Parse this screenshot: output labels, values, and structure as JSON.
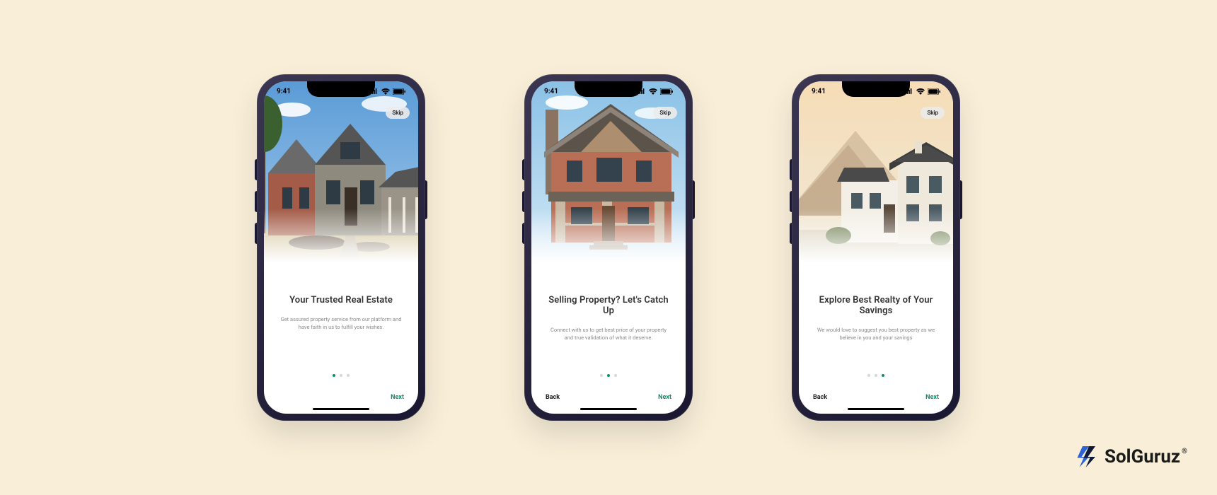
{
  "status": {
    "time": "9:41"
  },
  "skip_label": "Skip",
  "next_label": "Next",
  "back_label": "Back",
  "brand": {
    "name": "SolGuruz",
    "registered": "®"
  },
  "screens": [
    {
      "title": "Your Trusted Real Estate",
      "desc": "Get assured property service from our platform and have faith in us to fulfill your wishes.",
      "active_dot": 0,
      "show_back": false
    },
    {
      "title": "Selling Property? Let's Catch Up",
      "desc": "Connect with us to get best price of your property and true validation of what it deserve.",
      "active_dot": 1,
      "show_back": true
    },
    {
      "title": "Explore Best Realty of Your Savings",
      "desc": "We would love to suggest you best property as we believe in you and your savings",
      "active_dot": 2,
      "show_back": true
    }
  ]
}
